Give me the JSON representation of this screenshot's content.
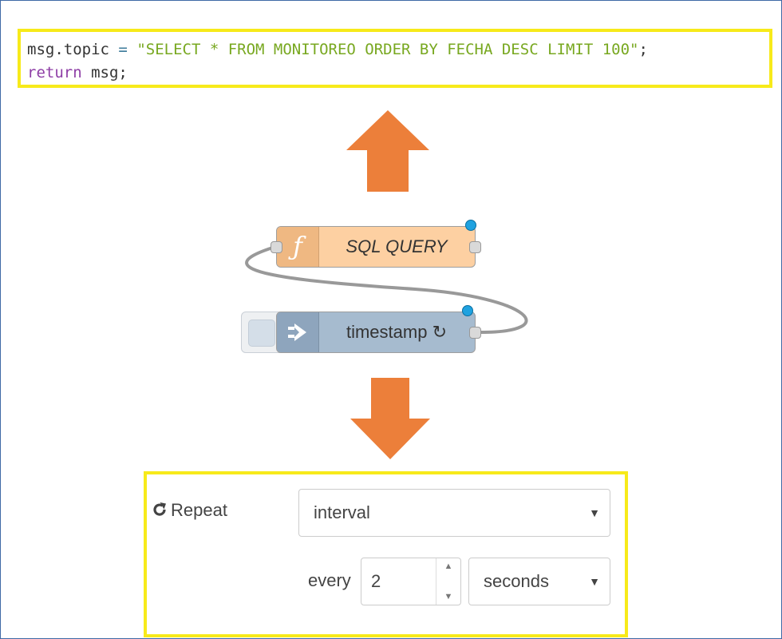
{
  "code": {
    "line1": {
      "var": "msg.topic",
      "op": "=",
      "str": "\"SELECT * FROM MONITOREO ORDER BY FECHA DESC LIMIT 100\"",
      "end": ";"
    },
    "line2": {
      "kw": "return",
      "rest": "msg;"
    }
  },
  "flow": {
    "function_node": {
      "label": "SQL QUERY",
      "icon": "function-icon",
      "color": "#fdd0a2"
    },
    "inject_node": {
      "label": "timestamp ↻",
      "icon": "inject-arrow-icon",
      "color": "#a6bbcf"
    },
    "arrow_color": "#ec7f3a"
  },
  "form": {
    "repeat_label": "Repeat",
    "repeat_value": "interval",
    "every_label": "every",
    "every_value": "2",
    "unit_value": "seconds"
  }
}
